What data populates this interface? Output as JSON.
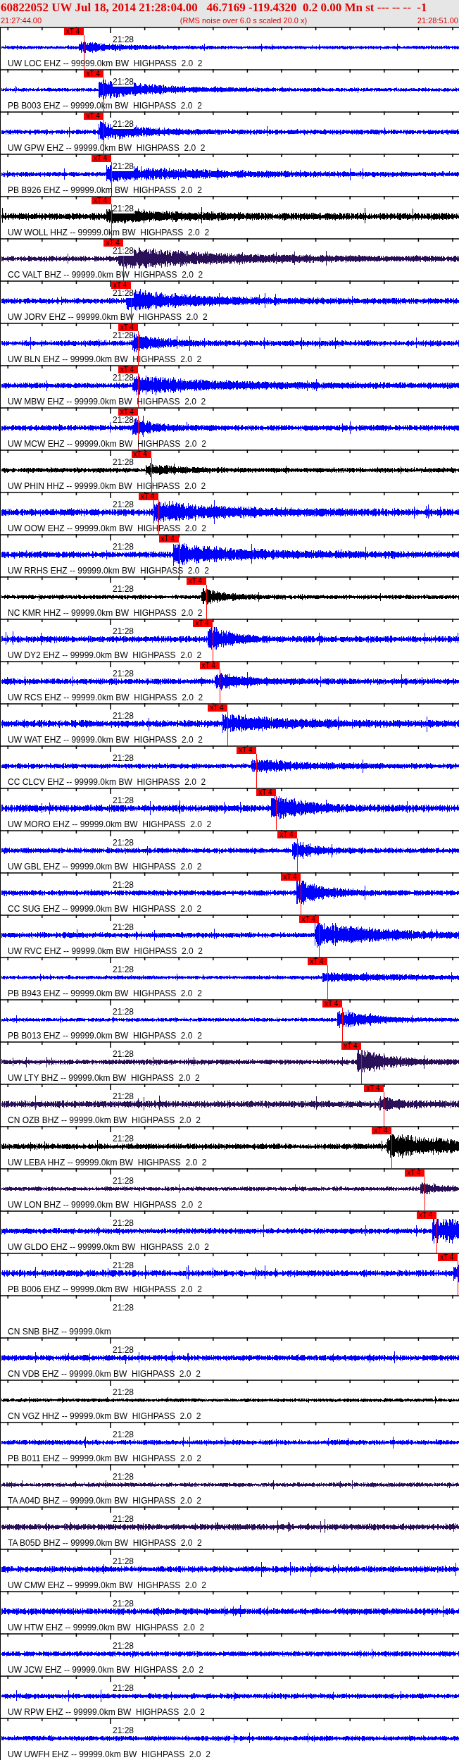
{
  "header": {
    "title": "60822052 UW Jul 18, 2014 21:28:04.00   46.7169 -119.4320  0.2 0.00 Mn st --- -- --  -1",
    "start_time": "21:27:44.00",
    "note": "(RMS noise over 6.0 s scaled 20.0 x)",
    "end_time": "21:28:51.00"
  },
  "traces": [
    {
      "label": "UW LOC EHZ -- 99999.0km BW  HIGHPASS  2.0  2",
      "time_label": "21:28",
      "color": "#0000ff",
      "signal": true,
      "pick": {
        "label": "xT 4"
      }
    },
    {
      "label": "PB B003 EHZ -- 99999.0km BW  HIGHPASS  2.0  2",
      "time_label": "21:28",
      "color": "#0000ff",
      "signal": true,
      "pick": {
        "label": "xT 4"
      }
    },
    {
      "label": "UW GPW EHZ -- 99999.0km BW  HIGHPASS  2.0  2",
      "time_label": "21:28",
      "color": "#0000ff",
      "signal": true,
      "pick": {
        "label": "xT 4"
      }
    },
    {
      "label": "PB B926 EHZ -- 99999.0km BW  HIGHPASS  2.0  2",
      "time_label": "21:28",
      "color": "#0000ff",
      "signal": true,
      "pick": {
        "label": "xT 4"
      }
    },
    {
      "label": "UW WOLL HHZ -- 99999.0km BW  HIGHPASS  2.0  2",
      "time_label": "21:28",
      "color": "#000000",
      "signal": true,
      "pick": {
        "label": "xT 4"
      }
    },
    {
      "label": "CC VALT BHZ -- 99999.0km BW  HIGHPASS  2.0  2",
      "time_label": "21:28",
      "color": "#2a1058",
      "signal": true,
      "pick": {
        "label": "xT 4"
      }
    },
    {
      "label": "UW JORV EHZ -- 99999.0km BW  HIGHPASS  2.0  2",
      "time_label": "21:28",
      "color": "#0000ff",
      "signal": true,
      "pick": {
        "label": "xT 4"
      }
    },
    {
      "label": "UW BLN EHZ -- 99999.0km BW  HIGHPASS  2.0  2",
      "time_label": "21:28",
      "color": "#0000ff",
      "signal": true,
      "pick": {
        "label": "xT 4"
      }
    },
    {
      "label": "UW MBW EHZ -- 99999.0km BW  HIGHPASS  2.0  2",
      "time_label": "21:28",
      "color": "#0000ff",
      "signal": true,
      "pick": {
        "label": "xT 4"
      }
    },
    {
      "label": "UW MCW EHZ -- 99999.0km BW  HIGHPASS  2.0  2",
      "time_label": "21:28",
      "color": "#0000ff",
      "signal": true,
      "pick": {
        "label": "xT 4"
      }
    },
    {
      "label": "UW PHIN HHZ -- 99999.0km BW  HIGHPASS  2.0  2",
      "time_label": "21:28",
      "color": "#000000",
      "signal": true,
      "pick": {
        "label": "xT 4"
      }
    },
    {
      "label": "UW OOW EHZ -- 99999.0km BW  HIGHPASS  2.0  2",
      "time_label": "21:28",
      "color": "#0000ff",
      "signal": true,
      "pick": {
        "label": "xT 4"
      }
    },
    {
      "label": "UW RRHS EHZ -- 99999.0km BW  HIGHPASS  2.0  2",
      "time_label": "21:28",
      "color": "#0000ff",
      "signal": true,
      "pick": {
        "label": "xT 4"
      }
    },
    {
      "label": "NC KMR HHZ -- 99999.0km BW  HIGHPASS  2.0  2",
      "time_label": "21:28",
      "color": "#000000",
      "signal": true,
      "pick": {
        "label": "xT 4"
      }
    },
    {
      "label": "UW DY2 EHZ -- 99999.0km BW  HIGHPASS  2.0  2",
      "time_label": "21:28",
      "color": "#0000ff",
      "signal": true,
      "pick": {
        "label": "xT 4"
      }
    },
    {
      "label": "UW RCS EHZ -- 99999.0km BW  HIGHPASS  2.0  2",
      "time_label": "21:28",
      "color": "#0000ff",
      "signal": true,
      "pick": {
        "label": "xT 4"
      }
    },
    {
      "label": "UW WAT EHZ -- 99999.0km BW  HIGHPASS  2.0  2",
      "time_label": "21:28",
      "color": "#0000ff",
      "signal": true,
      "pick": {
        "label": "xT 4"
      }
    },
    {
      "label": "CC CLCV EHZ -- 99999.0km BW  HIGHPASS  2.0  2",
      "time_label": "21:28",
      "color": "#0000ff",
      "signal": true,
      "pick": {
        "label": "xT 4"
      }
    },
    {
      "label": "UW MORO EHZ -- 99999.0km BW  HIGHPASS  2.0  2",
      "time_label": "21:28",
      "color": "#0000ff",
      "signal": true,
      "pick": {
        "label": "xT 4"
      }
    },
    {
      "label": "UW GBL EHZ -- 99999.0km BW  HIGHPASS  2.0  2",
      "time_label": "21:28",
      "color": "#0000ff",
      "signal": true,
      "pick": {
        "label": "xT 4"
      }
    },
    {
      "label": "CC SUG EHZ -- 99999.0km BW  HIGHPASS  2.0  2",
      "time_label": "21:28",
      "color": "#0000ff",
      "signal": true,
      "pick": {
        "label": "xT 4"
      }
    },
    {
      "label": "UW RVC EHZ -- 99999.0km BW  HIGHPASS  2.0  2",
      "time_label": "21:28",
      "color": "#0000ff",
      "signal": true,
      "pick": {
        "label": "xT 4"
      }
    },
    {
      "label": "PB B943 EHZ -- 99999.0km BW  HIGHPASS  2.0  2",
      "time_label": "21:28",
      "color": "#0000ff",
      "signal": true,
      "pick": {
        "label": "xT 4"
      }
    },
    {
      "label": "PB B013 EHZ -- 99999.0km BW  HIGHPASS  2.0  2",
      "time_label": "21:28",
      "color": "#0000ff",
      "signal": true,
      "pick": {
        "label": "xT 4"
      }
    },
    {
      "label": "UW LTY BHZ -- 99999.0km BW  HIGHPASS  2.0  2",
      "time_label": "21:28",
      "color": "#2a1058",
      "signal": true,
      "pick": {
        "label": "xT 4"
      }
    },
    {
      "label": "CN OZB BHZ -- 99999.0km BW  HIGHPASS  2.0  2",
      "time_label": "21:28",
      "color": "#2a1058",
      "signal": true,
      "pick": {
        "label": "xT 4"
      }
    },
    {
      "label": "UW LEBA HHZ -- 99999.0km BW  HIGHPASS  2.0  2",
      "time_label": "21:28",
      "color": "#000000",
      "signal": true,
      "pick": {
        "label": "xT 4"
      }
    },
    {
      "label": "UW LON BHZ -- 99999.0km BW  HIGHPASS  2.0  2",
      "time_label": "21:28",
      "color": "#2a1058",
      "signal": true,
      "pick": {
        "label": "xT 4"
      }
    },
    {
      "label": "UW GLDO EHZ -- 99999.0km BW  HIGHPASS  2.0  2",
      "time_label": "21:28",
      "color": "#0000ff",
      "signal": true,
      "pick": {
        "label": "xT 4"
      }
    },
    {
      "label": "PB B006 EHZ -- 99999.0km BW  HIGHPASS  2.0  2",
      "time_label": "21:28",
      "color": "#0000ff",
      "signal": true,
      "pick": {
        "label": "xT 4"
      }
    },
    {
      "label": "CN SNB BHZ -- 99999.0km",
      "time_label": "21:28",
      "signal": false
    },
    {
      "label": "CN VDB EHZ -- 99999.0km BW  HIGHPASS  2.0  2",
      "time_label": "21:28",
      "color": "#0000ff",
      "signal": true
    },
    {
      "label": "CN VGZ HHZ -- 99999.0km BW  HIGHPASS  2.0  2",
      "time_label": "21:28",
      "color": "#000000",
      "signal": true
    },
    {
      "label": "PB B011 EHZ -- 99999.0km BW  HIGHPASS  2.0  2",
      "time_label": "21:28",
      "color": "#0000ff",
      "signal": true
    },
    {
      "label": "TA A04D BHZ -- 99999.0km BW  HIGHPASS  2.0  2",
      "time_label": "21:28",
      "color": "#2a1058",
      "signal": true
    },
    {
      "label": "TA B05D BHZ -- 99999.0km BW  HIGHPASS  2.0  2",
      "time_label": "21:28",
      "color": "#2a1058",
      "signal": true
    },
    {
      "label": "UW CMW EHZ -- 99999.0km BW  HIGHPASS  2.0  2",
      "time_label": "21:28",
      "color": "#0000ff",
      "signal": true
    },
    {
      "label": "UW HTW EHZ -- 99999.0km BW  HIGHPASS  2.0  2",
      "time_label": "21:28",
      "color": "#0000ff",
      "signal": true
    },
    {
      "label": "UW JCW EHZ -- 99999.0km BW  HIGHPASS  2.0  2",
      "time_label": "21:28",
      "color": "#0000ff",
      "signal": true
    },
    {
      "label": "UW RPW EHZ -- 99999.0km BW  HIGHPASS  2.0  2",
      "time_label": "21:28",
      "color": "#0000ff",
      "signal": true
    },
    {
      "label": "UW UWFH EHZ -- 99999.0km BW  HIGHPASS  2.0  2",
      "time_label": "21:28",
      "color": "#0000ff",
      "signal": true
    }
  ]
}
